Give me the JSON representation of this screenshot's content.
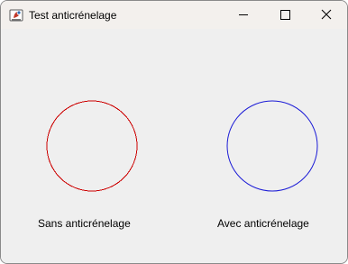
{
  "window": {
    "title": "Test anticrénelage"
  },
  "panels": [
    {
      "caption": "Sans anticrénelage",
      "circle_color": "#cc0000",
      "antialiased": false
    },
    {
      "caption": "Avec anticrénelage",
      "circle_color": "#1a1ad6",
      "antialiased": true
    }
  ],
  "icons": {
    "app": "java-app-icon",
    "minimize": "minimize-icon",
    "maximize": "maximize-icon",
    "close": "close-icon"
  }
}
